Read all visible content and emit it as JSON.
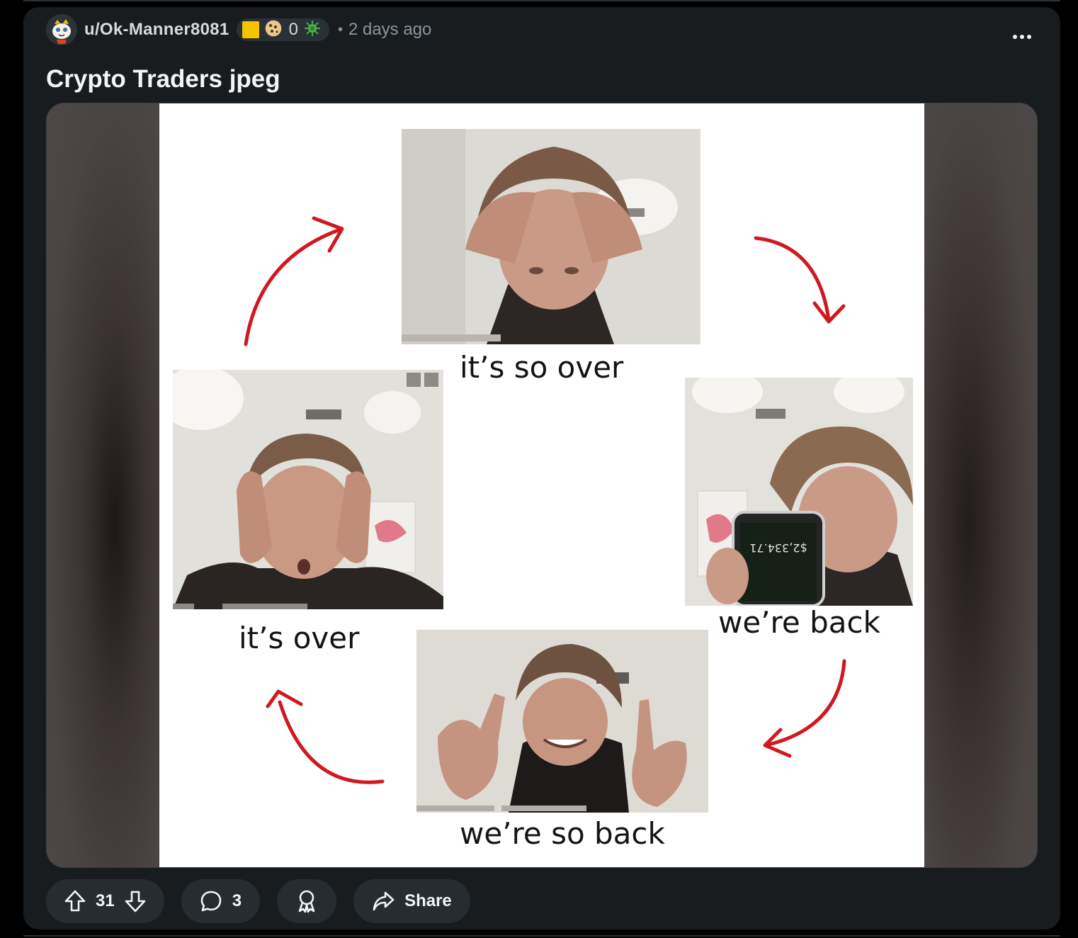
{
  "post": {
    "author": "u/Ok-Manner8081",
    "flair_count": "0",
    "separator": "•",
    "time": "2 days ago",
    "title": "Crypto Traders jpeg"
  },
  "meme": {
    "captions": {
      "top": "it’s so over",
      "right": "we’re back",
      "bottom": "we’re so back",
      "left": "it’s over"
    },
    "phone_text": "$2,334.71",
    "arrow_color": "#d0181f"
  },
  "actions": {
    "vote_count": "31",
    "comment_count": "3",
    "share_label": "Share"
  },
  "colors": {
    "card_bg": "#181c1f",
    "page_bg": "#000000",
    "pill_bg": "#262c30",
    "flair_gold": "#f5c400",
    "flair_green": "#4caf50"
  },
  "icons": [
    "avatar-icon",
    "flair-square-icon",
    "cookie-icon",
    "virus-icon",
    "more-icon",
    "upvote-icon",
    "downvote-icon",
    "comment-icon",
    "award-icon",
    "share-icon"
  ]
}
